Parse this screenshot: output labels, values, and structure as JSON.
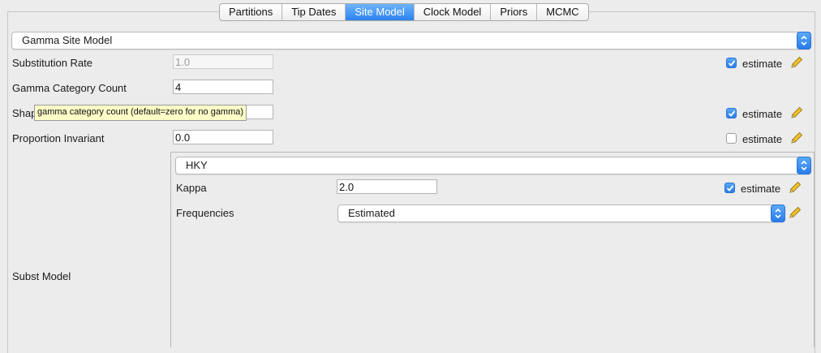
{
  "tabs": [
    {
      "label": "Partitions"
    },
    {
      "label": "Tip Dates"
    },
    {
      "label": "Site Model"
    },
    {
      "label": "Clock Model"
    },
    {
      "label": "Priors"
    },
    {
      "label": "MCMC"
    }
  ],
  "active_tab": "Site Model",
  "site_model_select": {
    "value": "Gamma Site Model"
  },
  "rows": {
    "substitution_rate": {
      "label": "Substitution Rate",
      "value": "1.0",
      "estimate_label": "estimate",
      "estimate_checked": true
    },
    "gamma_category_count": {
      "label": "Gamma Category Count",
      "value": "4"
    },
    "shape": {
      "label": "Shape",
      "estimate_label": "estimate",
      "estimate_checked": true
    },
    "proportion_invariant": {
      "label": "Proportion Invariant",
      "value": "0.0",
      "estimate_label": "estimate",
      "estimate_checked": false
    }
  },
  "tooltip": {
    "text": "gamma category count (default=zero for no gamma)"
  },
  "subst_model": {
    "label": "Subst Model",
    "select_value": "HKY",
    "kappa": {
      "label": "Kappa",
      "value": "2.0",
      "estimate_label": "estimate",
      "estimate_checked": true
    },
    "frequencies": {
      "label": "Frequencies",
      "select_value": "Estimated"
    }
  },
  "colors": {
    "accent": "#2c83f0",
    "tooltip_bg": "#fdfdc8",
    "background": "#ececec"
  },
  "icons": {
    "edit": "pencil-icon",
    "dropdown": "chevron-updown-icon",
    "check": "checkmark-icon"
  }
}
